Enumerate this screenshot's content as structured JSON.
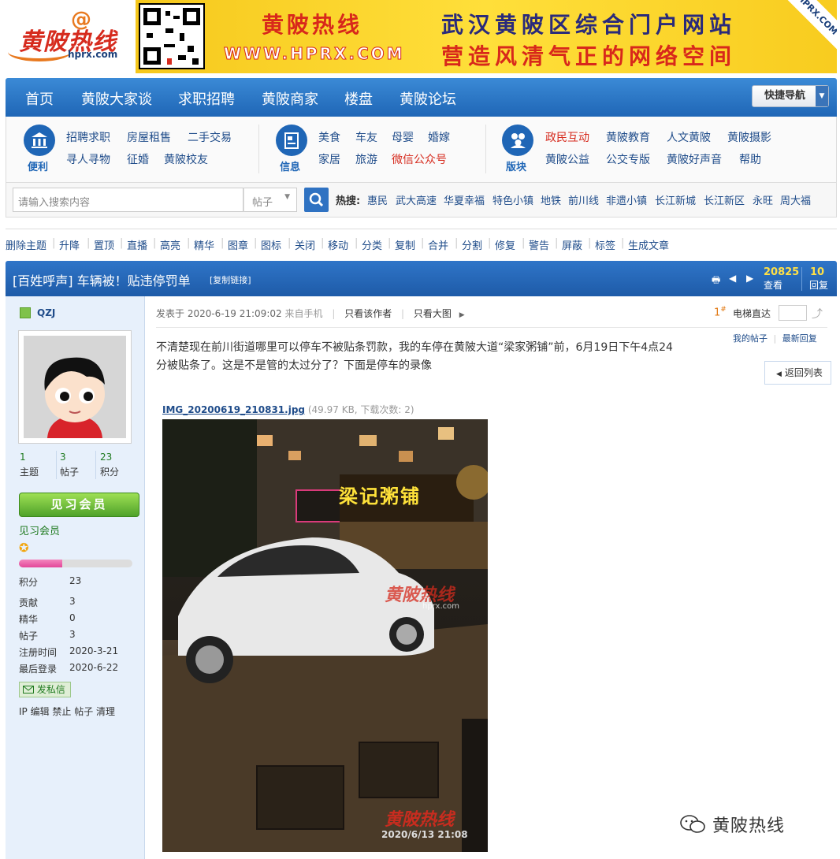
{
  "header": {
    "logo_text": "黄陂热线",
    "logo_url": "hprx.com",
    "banner_name": "黄陂热线",
    "banner_url": "WWW.HPRX.COM",
    "banner_slogan1": "武汉黄陂区综合门户网站",
    "banner_slogan2": "营造风清气正的网络空间",
    "banner_corner": "HPRX.COM"
  },
  "nav": {
    "items": [
      "首页",
      "黄陂大家谈",
      "求职招聘",
      "黄陂商家",
      "楼盘",
      "黄陂论坛"
    ],
    "quick_nav": "快捷导航"
  },
  "subnav": {
    "group1_label": "便利",
    "group1": [
      "招聘求职",
      "房屋租售",
      "二手交易",
      "寻人寻物",
      "征婚",
      "黄陂校友"
    ],
    "group2_label": "信息",
    "group2": [
      "美食",
      "车友",
      "母婴",
      "婚嫁",
      "家居",
      "旅游",
      "微信公众号"
    ],
    "group3_label": "版块",
    "group3": [
      "政民互动",
      "黄陂教育",
      "人文黄陂",
      "黄陂摄影",
      "黄陂公益",
      "公交专版",
      "黄陂好声音",
      "帮助"
    ],
    "red_color": "#d62b1e"
  },
  "search": {
    "placeholder": "请输入搜索内容",
    "scope": "帖子",
    "hot_label": "热搜:",
    "hot": [
      "惠民",
      "武大高速",
      "华夏幸福",
      "特色小镇",
      "地铁",
      "前川线",
      "非遗小镇",
      "长江新城",
      "长江新区",
      "永旺",
      "周大福"
    ]
  },
  "mod_actions": [
    "删除主题",
    "升降",
    "置顶",
    "直播",
    "高亮",
    "精华",
    "图章",
    "图标",
    "关闭",
    "移动",
    "分类",
    "复制",
    "合并",
    "分割",
    "修复",
    "警告",
    "屏蔽",
    "标签",
    "生成文章"
  ],
  "thread": {
    "title": "[百姓呼声] 车辆被！贴违停罚单",
    "copy_link": "[复制链接]",
    "views": "20825",
    "views_label": "查看",
    "replies": "10",
    "replies_label": "回复"
  },
  "author": {
    "name": "QZJ",
    "topics": "1",
    "topics_label": "主题",
    "posts": "3",
    "posts_label": "帖子",
    "credits": "23",
    "credits_label": "积分",
    "rank_badge": "见习会员",
    "rank": "见习会员",
    "progress": 0.38,
    "info": [
      {
        "k": "积分",
        "v": "23"
      },
      {
        "k": "贡献",
        "v": "3"
      },
      {
        "k": "精华",
        "v": "0"
      },
      {
        "k": "帖子",
        "v": "3"
      },
      {
        "k": "注册时间",
        "v": "2020-3-21"
      },
      {
        "k": "最后登录",
        "v": "2020-6-22"
      }
    ],
    "pm": "发私信",
    "admin": "IP 编辑 禁止 帖子 清理"
  },
  "post": {
    "posted": "发表于 2020-6-19 21:09:02",
    "from": "来自手机",
    "only_author": "只看该作者",
    "big_img": "只看大图",
    "floor": "1",
    "floor_mark": "#",
    "lift": "电梯直达",
    "my_posts": "我的帖子",
    "latest_reply": "最新回复",
    "back": "返回列表",
    "content": "不清楚现在前川街道哪里可以停车不被贴条罚款，我的车停在黄陂大道“梁家粥铺”前，6月19日下午4点24分被贴条了。这是不是管的太过分了？下面是停车的录像",
    "attach_name": "IMG_20200619_210831.jpg",
    "attach_info": "(49.97 KB, 下载次数: 2)",
    "photo_shop_sign": "梁记粥铺",
    "photo_watermark": "黄陂热线",
    "photo_watermark_url": "hprx.com",
    "photo_time": "2020/6/13 21:08"
  },
  "footer_watermark": "黄陂热线"
}
